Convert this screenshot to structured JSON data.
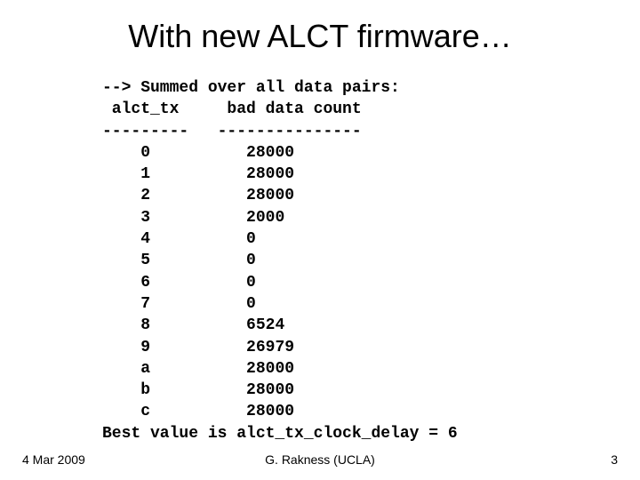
{
  "slide": {
    "title": "With new ALCT firmware…",
    "header_line": "--> Summed over all data pairs:",
    "col1_header": " alct_tx     bad data count",
    "divider": "---------   ---------------",
    "rows": [
      {
        "key": "    0",
        "val": "          28000"
      },
      {
        "key": "    1",
        "val": "          28000"
      },
      {
        "key": "    2",
        "val": "          28000"
      },
      {
        "key": "    3",
        "val": "          2000"
      },
      {
        "key": "    4",
        "val": "          0"
      },
      {
        "key": "    5",
        "val": "          0"
      },
      {
        "key": "    6",
        "val": "          0"
      },
      {
        "key": "    7",
        "val": "          0"
      },
      {
        "key": "    8",
        "val": "          6524"
      },
      {
        "key": "    9",
        "val": "          26979"
      },
      {
        "key": "    a",
        "val": "          28000"
      },
      {
        "key": "    b",
        "val": "          28000"
      },
      {
        "key": "    c",
        "val": "          28000"
      }
    ],
    "best_line": "Best value is alct_tx_clock_delay = 6"
  },
  "footer": {
    "date": "4 Mar 2009",
    "author": "G. Rakness (UCLA)",
    "page": "3"
  }
}
